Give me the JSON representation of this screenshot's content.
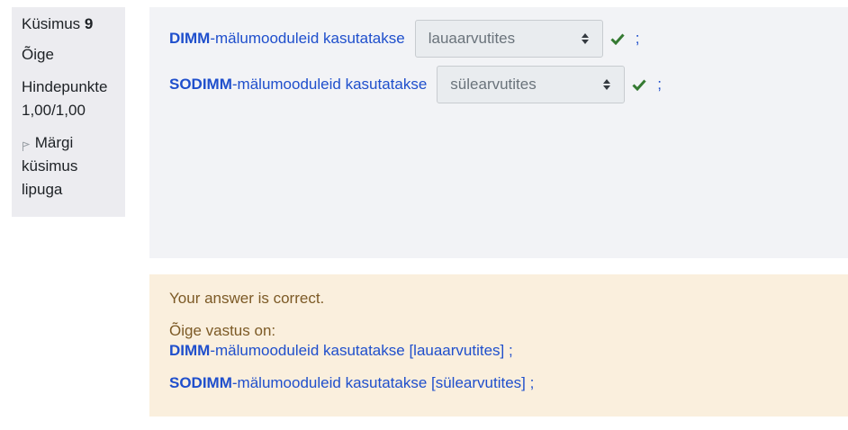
{
  "question_info": {
    "label": "Küsimus",
    "number": "9",
    "state": "Õige",
    "grade_line1": "Hindepunkte",
    "grade_line2": "1,00/1,00",
    "flag_line1": "Märgi",
    "flag_line2": "küsimus",
    "flag_line3": "lipuga"
  },
  "items": [
    {
      "term": "DIMM",
      "suffix": "-mälumooduleid kasutatakse",
      "selected": "lauaarvutites",
      "separator": ";"
    },
    {
      "term": "SODIMM",
      "suffix": "-mälumooduleid kasutatakse",
      "selected": "sülearvutites",
      "separator": ";"
    }
  ],
  "feedback": {
    "result": "Your answer is correct.",
    "right_answer_label": "Õige vastus on:",
    "answers": [
      {
        "term": "DIMM",
        "rest": "-mälumooduleid kasutatakse  [lauaarvutites] ;"
      },
      {
        "term": "SODIMM",
        "rest": "-mälumooduleid kasutatakse [sülearvutites] ;"
      }
    ]
  },
  "colors": {
    "link_blue": "#1f4fcc",
    "check_green": "#357a32",
    "feedback_bg": "#faefdd",
    "feedback_text": "#7c5a26"
  }
}
